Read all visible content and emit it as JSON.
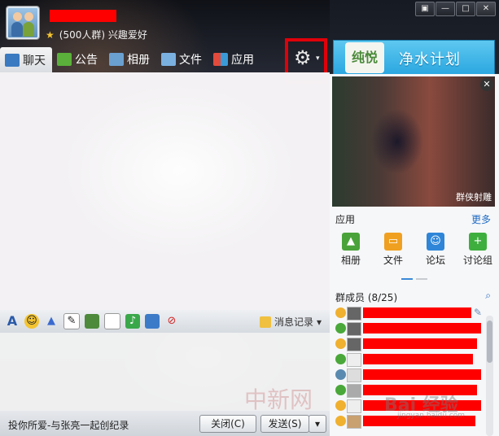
{
  "header": {
    "group_info": "(500人群) 兴趣爱好"
  },
  "window_buttons": [
    "▣",
    "—",
    "□",
    "✕"
  ],
  "tabs": [
    {
      "label": "聊天",
      "icon": "chat-icon",
      "active": true
    },
    {
      "label": "公告",
      "icon": "announcement-icon"
    },
    {
      "label": "相册",
      "icon": "album-icon"
    },
    {
      "label": "文件",
      "icon": "folder-icon"
    },
    {
      "label": "应用",
      "icon": "apps-icon"
    }
  ],
  "settings": {
    "icon": "gear-icon",
    "arrow": "▾"
  },
  "ad": {
    "brand": "纯悦",
    "text": "净水计划"
  },
  "toolbar": {
    "message_log_label": "消息记录",
    "icons": [
      "font-icon",
      "emoji-icon",
      "magic-icon",
      "scribble-icon",
      "image-icon",
      "file-send-icon",
      "music-icon",
      "screen-share-icon",
      "block-icon"
    ]
  },
  "bottom": {
    "signature": "投你所爱-与张亮一起创纪录",
    "close_label": "关闭(C)",
    "send_label": "发送(S)",
    "send_dropdown": "▾"
  },
  "video": {
    "caption": "群侠射雕",
    "close": "✕"
  },
  "apps_section": {
    "title": "应用",
    "more": "更多",
    "items": [
      {
        "label": "相册",
        "color": "#4aa33a"
      },
      {
        "label": "文件",
        "color": "#f0a020"
      },
      {
        "label": "论坛",
        "color": "#2f86d8"
      },
      {
        "label": "讨论组",
        "color": "#3eae3e"
      }
    ]
  },
  "members": {
    "title": "群成员 (8/25)",
    "count": 8
  },
  "watermarks": {
    "chinanews": "中新网",
    "jingyan": "Bai 经验",
    "jingyan_sub": "jingyan.baidu.com"
  },
  "colors": {
    "highlight_red": "#e0000a",
    "redaction": "#ff0000"
  }
}
